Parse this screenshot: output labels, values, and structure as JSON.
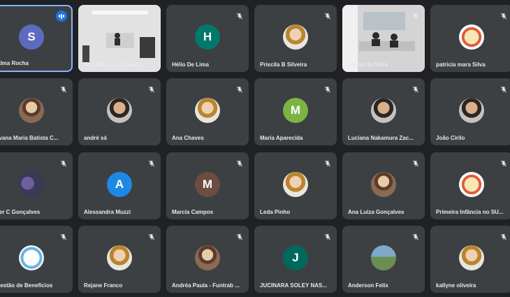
{
  "participants": [
    {
      "name": "alma Rocha",
      "avatar": {
        "kind": "letter",
        "letter": "S",
        "color": "#5c6bc0"
      },
      "speaking": true,
      "muted": false
    },
    {
      "name": "Ana Maria de Almeida",
      "avatar": {
        "kind": "video"
      },
      "speaking": false,
      "muted": false
    },
    {
      "name": "Hélio De Lima",
      "avatar": {
        "kind": "letter",
        "letter": "H",
        "color": "#00796b"
      },
      "speaking": false,
      "muted": true
    },
    {
      "name": "Priscila B Silveira",
      "avatar": {
        "kind": "photo"
      },
      "speaking": false,
      "muted": true
    },
    {
      "name": "Mekiel da Silva",
      "avatar": {
        "kind": "video"
      },
      "speaking": false,
      "muted": true
    },
    {
      "name": "patricia mara Silva",
      "avatar": {
        "kind": "photo"
      },
      "speaking": false,
      "muted": true
    },
    {
      "name": "ilvana Maria Batista C...",
      "avatar": {
        "kind": "photo"
      },
      "speaking": false,
      "muted": true
    },
    {
      "name": "andré sá",
      "avatar": {
        "kind": "photo"
      },
      "speaking": false,
      "muted": true
    },
    {
      "name": "Ana Chaves",
      "avatar": {
        "kind": "photo"
      },
      "speaking": false,
      "muted": true
    },
    {
      "name": "Maria Aparecida",
      "avatar": {
        "kind": "letter",
        "letter": "M",
        "color": "#7cb342"
      },
      "speaking": false,
      "muted": true
    },
    {
      "name": "Luciana Nakamura Zac...",
      "avatar": {
        "kind": "photo"
      },
      "speaking": false,
      "muted": true
    },
    {
      "name": "João Cirilo",
      "avatar": {
        "kind": "photo"
      },
      "speaking": false,
      "muted": true
    },
    {
      "name": "der C Gonçalves",
      "avatar": {
        "kind": "photo"
      },
      "speaking": false,
      "muted": true
    },
    {
      "name": "Alessandra Muzzi",
      "avatar": {
        "kind": "letter",
        "letter": "A",
        "color": "#1e88e5"
      },
      "speaking": false,
      "muted": true
    },
    {
      "name": "Marcia Campos",
      "avatar": {
        "kind": "letter",
        "letter": "M",
        "color": "#6d4c41"
      },
      "speaking": false,
      "muted": true
    },
    {
      "name": "Leda Pinho",
      "avatar": {
        "kind": "photo"
      },
      "speaking": false,
      "muted": true
    },
    {
      "name": "Ana Luiza Gonçalves",
      "avatar": {
        "kind": "photo"
      },
      "speaking": false,
      "muted": true
    },
    {
      "name": "Primeira Infância no SU...",
      "avatar": {
        "kind": "photo"
      },
      "speaking": false,
      "muted": true
    },
    {
      "name": "Gestão de Benefícios",
      "avatar": {
        "kind": "photo"
      },
      "speaking": false,
      "muted": true
    },
    {
      "name": "Rejane Franco",
      "avatar": {
        "kind": "photo"
      },
      "speaking": false,
      "muted": true
    },
    {
      "name": "Andréa Paula - Funtrab ...",
      "avatar": {
        "kind": "photo"
      },
      "speaking": false,
      "muted": true
    },
    {
      "name": "JUCINARA SOLEY NAS...",
      "avatar": {
        "kind": "letter",
        "letter": "J",
        "color": "#00695c"
      },
      "speaking": false,
      "muted": true
    },
    {
      "name": "Anderson Felix",
      "avatar": {
        "kind": "photo"
      },
      "speaking": false,
      "muted": true
    },
    {
      "name": "kallyne oliveira",
      "avatar": {
        "kind": "photo"
      },
      "speaking": false,
      "muted": true
    }
  ]
}
